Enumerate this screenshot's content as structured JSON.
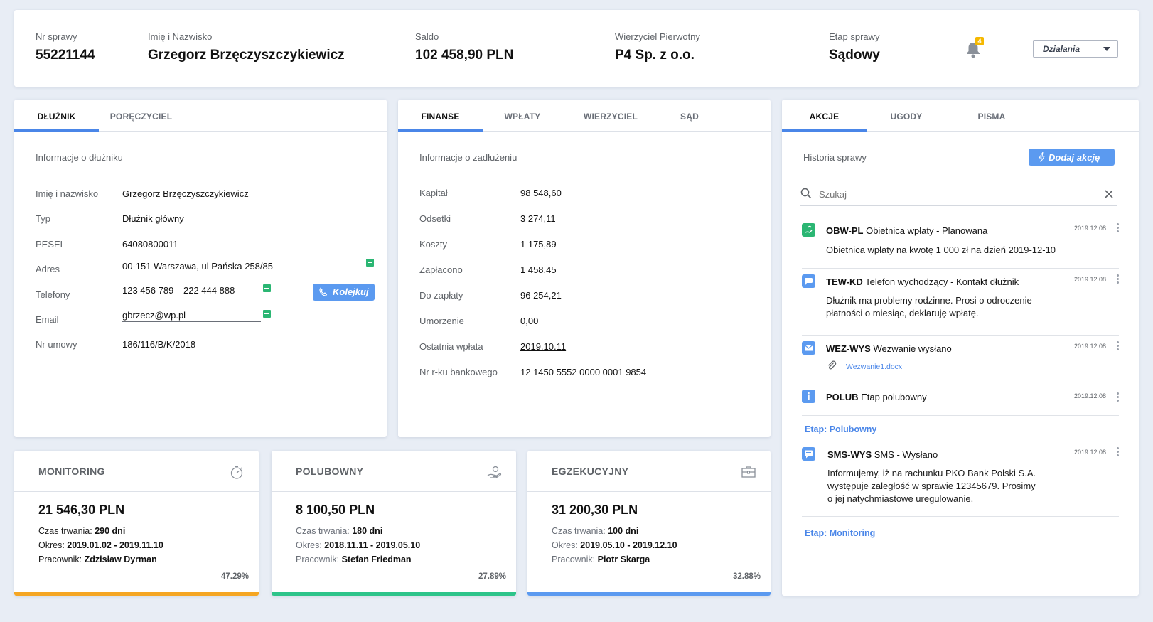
{
  "header": {
    "nr_label": "Nr sprawy",
    "nr_value": "55221144",
    "name_label": "Imię i Nazwisko",
    "name_value": "Grzegorz Brzęczyszczykiewicz",
    "saldo_label": "Saldo",
    "saldo_value": "102 458,90 PLN",
    "creditor_label": "Wierzyciel Pierwotny",
    "creditor_value": "P4 Sp. z o.o.",
    "stage_label": "Etap sprawy",
    "stage_value": "Sądowy",
    "notif_count": "4",
    "actions_dropdown": "Działania"
  },
  "debtor": {
    "tabs": [
      "DŁUŻNIK",
      "PORĘCZYCIEL"
    ],
    "section": "Informacje o dłużniku",
    "rows": [
      {
        "k": "Imię i nazwisko",
        "v": "Grzegorz Brzęczyszczykiewicz"
      },
      {
        "k": "Typ",
        "v": "Dłużnik główny"
      },
      {
        "k": "PESEL",
        "v": "64080800011"
      },
      {
        "k": "Adres",
        "v": "00-151 Warszawa, ul Pańska 258/85"
      },
      {
        "k": "Telefony",
        "v": "123 456 789",
        "v2": "222 444 888"
      },
      {
        "k": "Email",
        "v": "gbrzecz@wp.pl"
      },
      {
        "k": "Nr umowy",
        "v": "186/116/B/K/2018"
      }
    ],
    "queue_button": "Kolejkuj"
  },
  "finance": {
    "tabs": [
      "FINANSE",
      "WPŁATY",
      "WIERZYCIEL",
      "SĄD"
    ],
    "section": "Informacje o zadłużeniu",
    "rows": [
      {
        "k": "Kapitał",
        "v": "98 548,60"
      },
      {
        "k": "Odsetki",
        "v": "3 274,11"
      },
      {
        "k": "Koszty",
        "v": "1 175,89"
      },
      {
        "k": "Zapłacono",
        "v": "1 458,45"
      },
      {
        "k": "Do zapłaty",
        "v": "96 254,21"
      },
      {
        "k": "Umorzenie",
        "v": "0,00"
      },
      {
        "k": "Ostatnia wpłata",
        "v": "2019.10.11"
      },
      {
        "k": "Nr r-ku bankowego",
        "v": "12 1450 5552 0000 0001 9854"
      }
    ]
  },
  "actions": {
    "tabs": [
      "AKCJE",
      "UGODY",
      "PISMA"
    ],
    "section": "Historia sprawy",
    "add_button": "Dodaj akcję",
    "search_placeholder": "Szukaj",
    "items": [
      {
        "code": "OBW-PL",
        "title": "Obietnica wpłaty - Planowana",
        "date": "2019.12.08",
        "body": "Obietnica wpłaty na kwotę 1 000 zł na dzień 2019-12-10",
        "icon": "promise-icon",
        "color": "#2bb673"
      },
      {
        "code": "TEW-KD",
        "title": "Telefon wychodzący - Kontakt dłużnik",
        "date": "2019.12.08",
        "body": "Dłużnik ma problemy rodzinne. Prosi o odroczenie płatności o miesiąc, deklaruję wpłatę.",
        "icon": "phone-chat-icon",
        "color": "#5b9af0"
      },
      {
        "code": "WEZ-WYS",
        "title": "Wezwanie wysłano",
        "date": "2019.12.08",
        "attachment": "Wezwanie1.docx",
        "icon": "mail-icon",
        "color": "#5b9af0"
      },
      {
        "code": "POLUB",
        "title": "Etap polubowny",
        "date": "2019.12.08",
        "icon": "info-icon",
        "color": "#5b9af0"
      },
      {
        "code": "SMS-WYS",
        "title": "SMS - Wysłano",
        "date": "2019.12.08",
        "body": "Informujemy, iż na rachunku PKO Bank Polski S.A. występuje zaległość w sprawie 12345679. Prosimy o jej natychmiastowe uregulowanie.",
        "icon": "sms-icon",
        "color": "#5b9af0"
      }
    ],
    "stage_polubowny": "Etap: Polubowny",
    "stage_monitoring": "Etap: Monitoring"
  },
  "stages": [
    {
      "title": "MONITORING",
      "amount": "21 546,30 PLN",
      "duration_label": "Czas trwania:",
      "duration": "290 dni",
      "period_label": "Okres:",
      "period": "2019.01.02 - 2019.11.10",
      "worker_label": "Pracownik:",
      "worker": "Zdzisław Dyrman",
      "percent": "47.29%",
      "color": "#f5a623",
      "icon": "stopwatch-icon"
    },
    {
      "title": "POLUBOWNY",
      "amount": "8 100,50 PLN",
      "duration_label": "Czas trwania:",
      "duration": "180 dni",
      "period_label": "Okres:",
      "period": "2018.11.11 - 2019.05.10",
      "worker_label": "Pracownik:",
      "worker": "Stefan Friedman",
      "percent": "27.89%",
      "color": "#2ec48a",
      "icon": "hand-coin-icon"
    },
    {
      "title": "EGZEKUCYJNY",
      "amount": "31 200,30 PLN",
      "duration_label": "Czas trwania:",
      "duration": "100 dni",
      "period_label": "Okres:",
      "period": "2019.05.10 - 2019.12.10",
      "worker_label": "Pracownik:",
      "worker": "Piotr Skarga",
      "percent": "32.88%",
      "color": "#5b9af0",
      "icon": "briefcase-icon"
    }
  ]
}
